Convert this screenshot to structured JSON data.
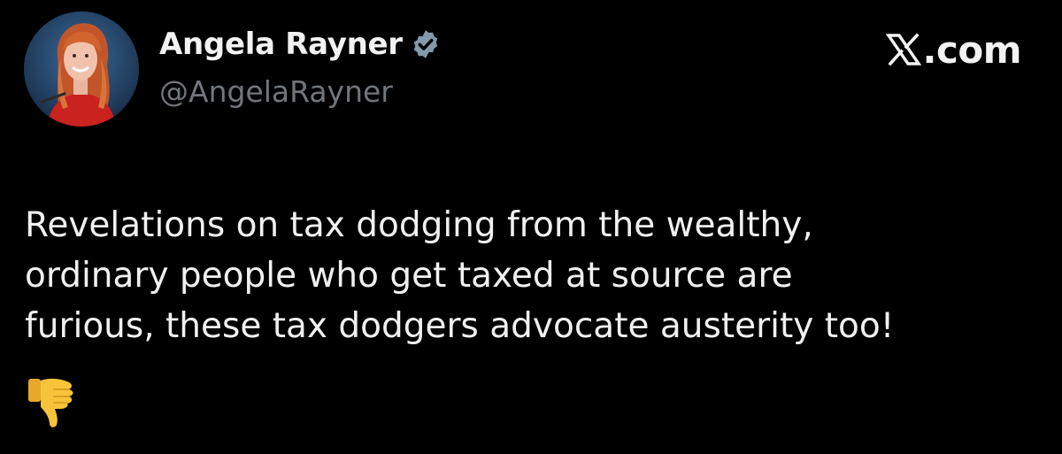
{
  "author": {
    "display_name": "Angela Rayner",
    "handle": "@AngelaRayner",
    "verified": true,
    "avatar_description_icon": "profile-photo"
  },
  "brand": {
    "text": ".com",
    "logo_icon": "x-logo-icon"
  },
  "tweet": {
    "lines": [
      "Revelations on tax dodging from the wealthy,",
      "ordinary people who get taxed at source are",
      "furious, these tax dodgers advocate austerity too!"
    ],
    "emoji": "👎"
  },
  "colors": {
    "background": "#000000",
    "text": "#e7e9ea",
    "handle": "#71767b",
    "verified_badge": "#829aab",
    "emoji": "#f7c33b"
  }
}
